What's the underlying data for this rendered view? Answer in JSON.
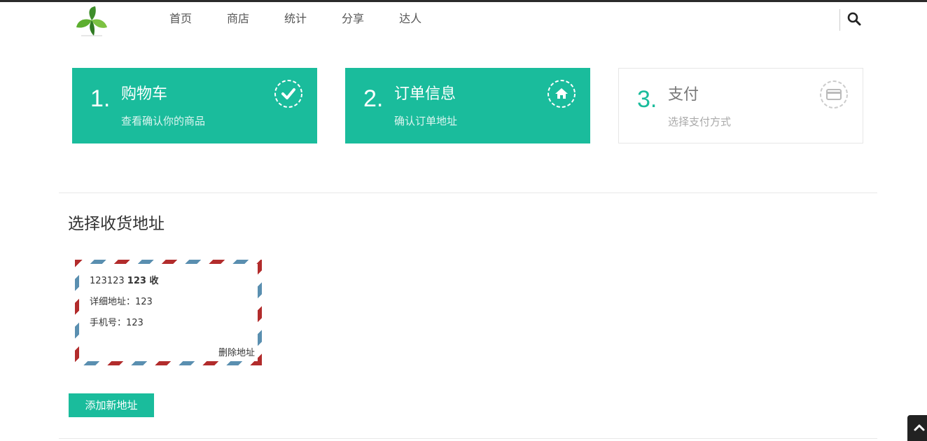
{
  "header": {
    "logo_icon": "leaf-logo-icon",
    "nav": [
      "首页",
      "商店",
      "统计",
      "分享",
      "达人"
    ],
    "search_icon": "search-icon"
  },
  "steps": [
    {
      "number": "1.",
      "title": "购物车",
      "desc": "查看确认你的商品",
      "icon": "check-circle-icon",
      "state": "active"
    },
    {
      "number": "2.",
      "title": "订单信息",
      "desc": "确认订单地址",
      "icon": "home-circle-icon",
      "state": "active"
    },
    {
      "number": "3.",
      "title": "支付",
      "desc": "选择支付方式",
      "icon": "credit-card-circle-icon",
      "state": "inactive"
    }
  ],
  "address_section": {
    "title": "选择收货地址",
    "card": {
      "name_prefix": "123123",
      "name_bold": "123 收",
      "detail_label": "详细地址：",
      "detail_value": "123",
      "phone_label": "手机号：",
      "phone_value": "123",
      "delete_label": "删除地址"
    },
    "add_button": "添加新地址"
  },
  "colors": {
    "accent": "#1abc9c",
    "envelope_red": "#b22c2c",
    "envelope_blue": "#5a8fb0"
  },
  "back_to_top_icon": "chevron-up-icon"
}
